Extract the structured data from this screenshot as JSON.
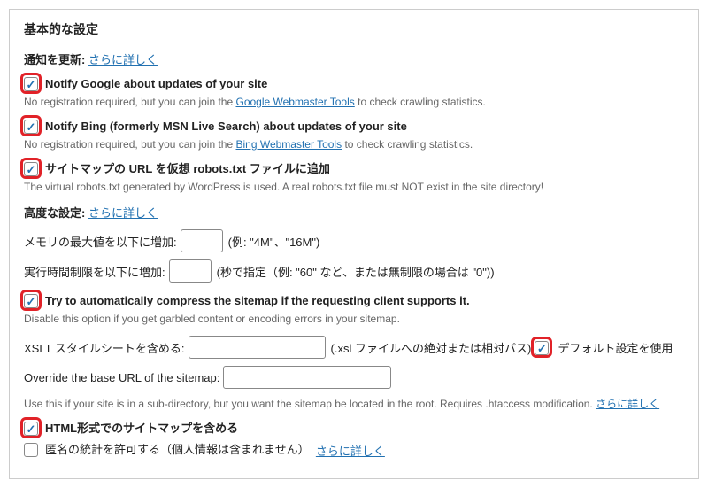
{
  "section_title": "基本的な設定",
  "notify": {
    "heading_label": "通知を更新:",
    "more_link": "さらに詳しく"
  },
  "google": {
    "label": "Notify Google about updates of your site",
    "desc_pre": "No registration required, but you can join the ",
    "desc_link": "Google Webmaster Tools",
    "desc_post": " to check crawling statistics."
  },
  "bing": {
    "label": "Notify Bing (formerly MSN Live Search) about updates of your site",
    "desc_pre": "No registration required, but you can join the ",
    "desc_link": "Bing Webmaster Tools",
    "desc_post": " to check crawling statistics."
  },
  "robots": {
    "label": "サイトマップの URL を仮想 robots.txt ファイルに追加",
    "desc": "The virtual robots.txt generated by WordPress is used. A real robots.txt file must NOT exist in the site directory!"
  },
  "advanced": {
    "heading_label": "高度な設定:",
    "more_link": "さらに詳しく"
  },
  "memory": {
    "label": "メモリの最大値を以下に増加:",
    "hint": "(例: \"4M\"、\"16M\")"
  },
  "exectime": {
    "label": "実行時間制限を以下に増加:",
    "hint": "(秒で指定（例: \"60\" など、または無制限の場合は \"0\"))"
  },
  "compress": {
    "label": "Try to automatically compress the sitemap if the requesting client supports it.",
    "desc": "Disable this option if you get garbled content or encoding errors in your sitemap."
  },
  "xslt": {
    "label": "XSLT スタイルシートを含める:",
    "hint": "(.xsl ファイルへの絶対または相対パス)",
    "default_label": "デフォルト設定を使用"
  },
  "override": {
    "label": "Override the base URL of the sitemap:",
    "desc_pre": "Use this if your site is in a sub-directory, but you want the sitemap be located in the root. Requires .htaccess modification. ",
    "desc_link": "さらに詳しく"
  },
  "html": {
    "label": "HTML形式でのサイトマップを含める"
  },
  "anon": {
    "label": "匿名の統計を許可する（個人情報は含まれません）",
    "link": "さらに詳しく"
  }
}
